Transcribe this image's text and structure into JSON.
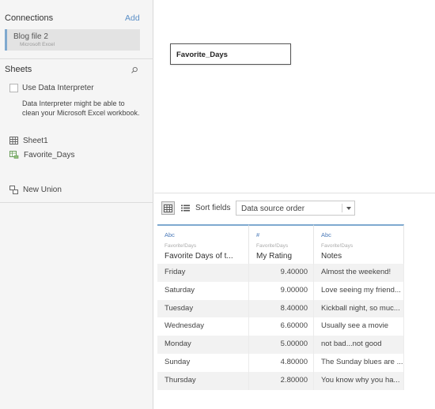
{
  "connections": {
    "title": "Connections",
    "add_label": "Add",
    "items": [
      {
        "name": "Blog file 2",
        "type": "Microsoft Excel"
      }
    ]
  },
  "sheets": {
    "title": "Sheets",
    "interpreter_label": "Use Data Interpreter",
    "interpreter_description": "Data Interpreter might be able to clean your Microsoft Excel workbook.",
    "items": [
      {
        "name": "Sheet1",
        "icon": "sheet-grid-icon"
      },
      {
        "name": "Favorite_Days",
        "icon": "named-range-icon"
      }
    ],
    "new_union_label": "New Union"
  },
  "canvas": {
    "table_name": "Favorite_Days"
  },
  "toolbar": {
    "sort_label": "Sort fields",
    "sort_value": "Data source order"
  },
  "grid": {
    "columns": [
      {
        "type": "Abc",
        "source": "Favorite!Days",
        "name": "Favorite Days of t..."
      },
      {
        "type": "#",
        "source": "Favorite!Days",
        "name": "My Rating"
      },
      {
        "type": "Abc",
        "source": "Favorite!Days",
        "name": "Notes"
      }
    ],
    "rows": [
      [
        "Friday",
        "9.40000",
        "Almost the weekend!"
      ],
      [
        "Saturday",
        "9.00000",
        "Love seeing my friend..."
      ],
      [
        "Tuesday",
        "8.40000",
        "Kickball night, so muc..."
      ],
      [
        "Wednesday",
        "6.60000",
        "Usually see a movie"
      ],
      [
        "Monday",
        "5.00000",
        "not bad...not good"
      ],
      [
        "Sunday",
        "4.80000",
        "The Sunday blues are ..."
      ],
      [
        "Thursday",
        "2.80000",
        "You know why you ha..."
      ]
    ]
  },
  "colors": {
    "accent": "#7fa9cf",
    "link": "#5b8fc7",
    "type_icon": "#4a79b8",
    "sidebar_bg": "#f5f5f5",
    "alt_row": "#f2f2f2"
  }
}
